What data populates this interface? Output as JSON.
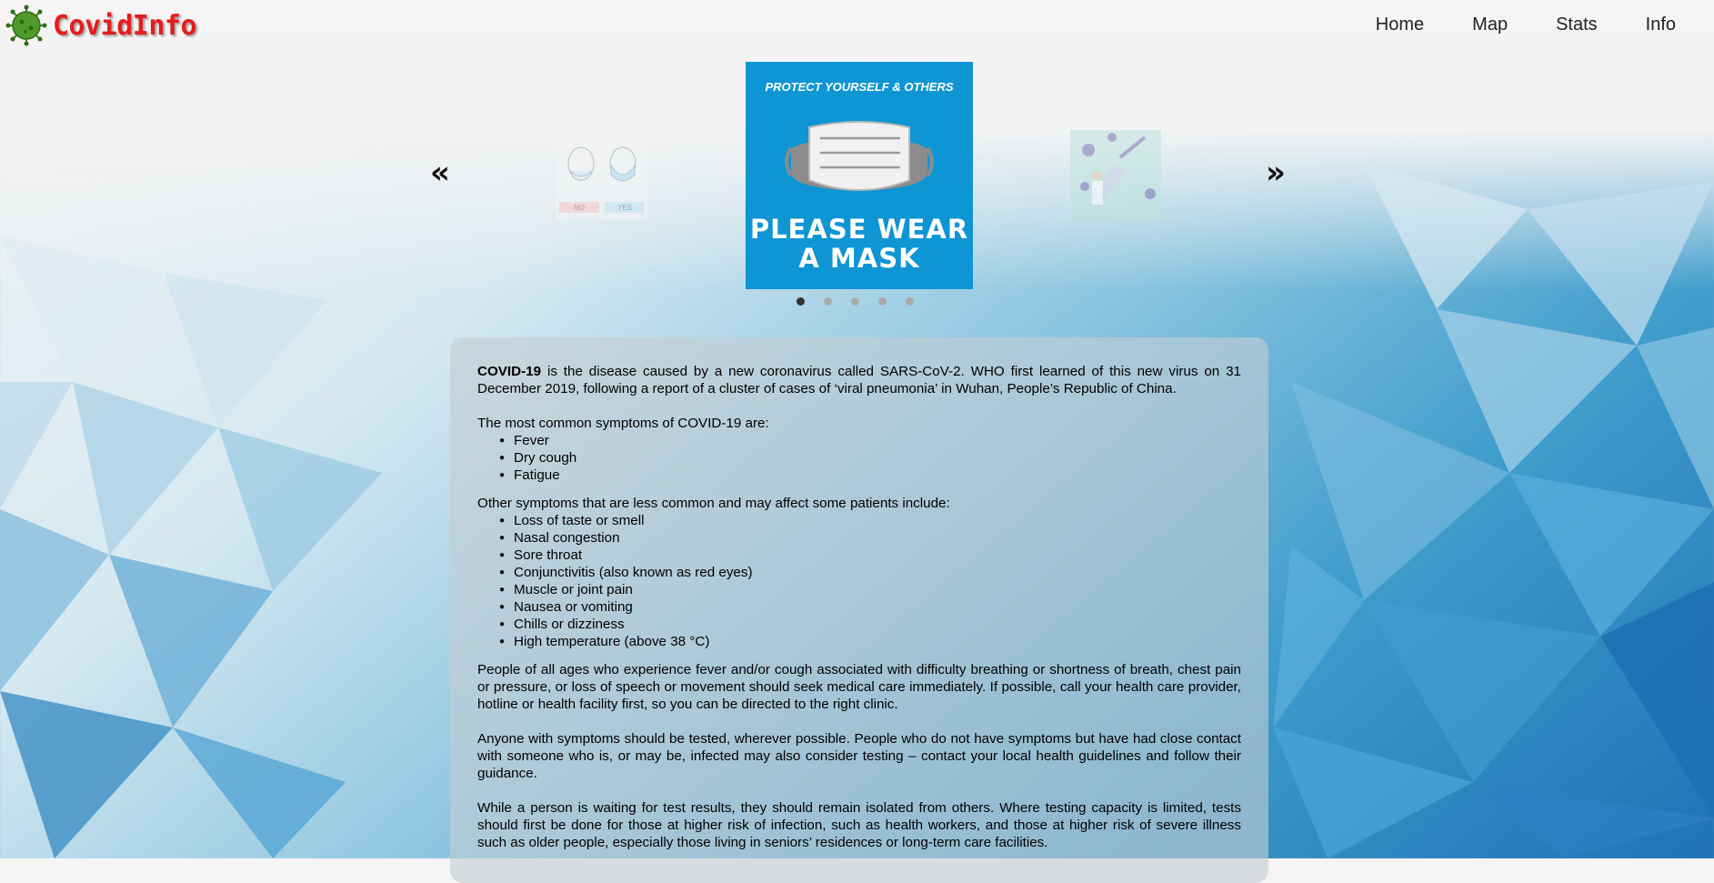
{
  "app": {
    "logo_text": "CovidInfo",
    "brand_color": "#e41d1d"
  },
  "nav": {
    "items": [
      "Home",
      "Map",
      "Stats",
      "Info"
    ]
  },
  "carousel": {
    "prev_symbol": "«",
    "next_symbol": "»",
    "main_slide": {
      "top_text": "PROTECT YOURSELF & OTHERS",
      "bottom_line1": "PLEASE WEAR",
      "bottom_line2": "A MASK",
      "background": "#0e95d3"
    },
    "left_slide": {
      "label_no": "NO",
      "label_yes": "YES"
    },
    "dot_count": 5,
    "active_dot": 0
  },
  "info": {
    "intro_bold": "COVID-19",
    "intro_rest": " is the disease caused by a new coronavirus called SARS-CoV-2. WHO first learned of this new virus on 31 December 2019, following a report of a cluster of cases of ‘viral pneumonia’ in Wuhan, People’s Republic of China.",
    "common_heading": "The most common symptoms of COVID-19 are:",
    "common_symptoms": [
      "Fever",
      "Dry cough",
      "Fatigue"
    ],
    "other_heading": "Other symptoms that are less common and may affect some patients include:",
    "other_symptoms": [
      "Loss of taste or smell",
      "Nasal congestion",
      "Sore throat",
      "Conjunctivitis (also known as red eyes)",
      "Muscle or joint pain",
      "Nausea or vomiting",
      "Chills or dizziness",
      "High temperature (above 38 °C)"
    ],
    "para_medical": "People of all ages who experience fever and/or cough associated with difficulty breathing or shortness of breath, chest pain or pressure, or loss of speech or movement should seek medical care immediately. If possible, call your health care provider, hotline or health facility first, so you can be directed to the right clinic.",
    "para_testing": "Anyone with symptoms should be tested, wherever possible. People who do not have symptoms but have had close contact with someone who is, or may be, infected may also consider testing – contact your local health guidelines and follow their guidance.",
    "para_waiting": "While a person is waiting for test results, they should remain isolated from others. Where testing capacity is limited, tests should first be done for those at higher risk of infection, such as health workers, and those at higher risk of severe illness such as older people, especially those living in seniors’ residences or long-term care facilities."
  }
}
